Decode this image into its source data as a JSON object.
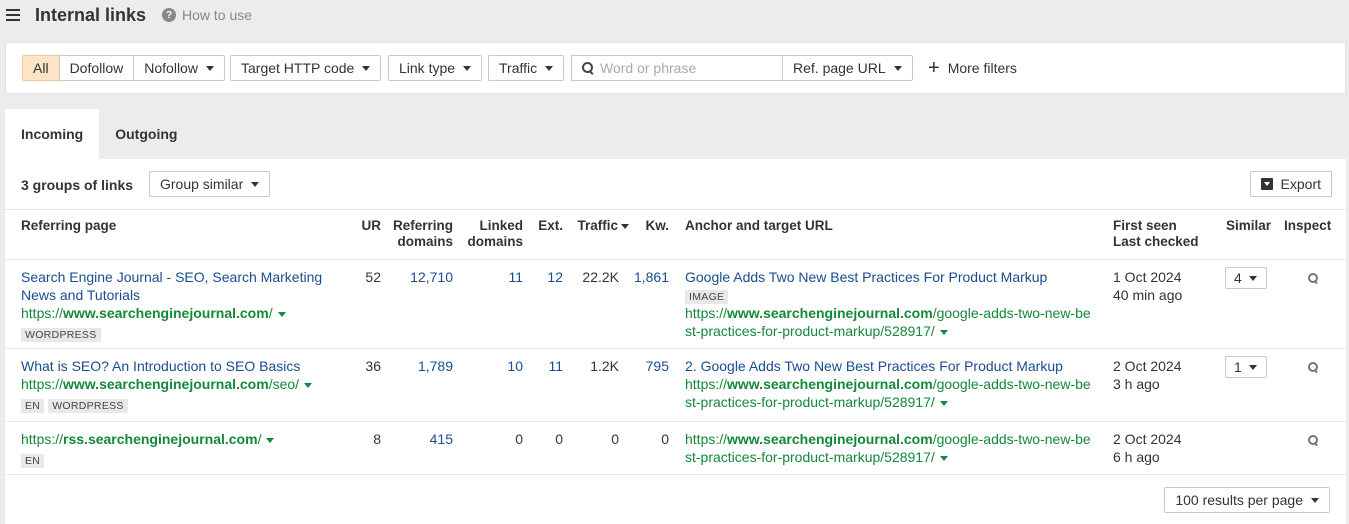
{
  "header": {
    "title": "Internal links",
    "help_label": "How to use",
    "help_icon": "question-circle-icon"
  },
  "filters": {
    "segment": [
      "All",
      "Dofollow",
      "Nofollow"
    ],
    "target_http_code": "Target HTTP code",
    "link_type": "Link type",
    "traffic": "Traffic",
    "search_placeholder": "Word or phrase",
    "search_value": "",
    "ref_page_url": "Ref. page URL",
    "more_filters": "More filters"
  },
  "tabs": [
    "Incoming",
    "Outgoing"
  ],
  "toolbar": {
    "groups_count": "3 groups of links",
    "group_similar": "Group similar",
    "export": "Export"
  },
  "table": {
    "columns": {
      "referring_page": "Referring page",
      "ur": "UR",
      "referring_domains": [
        "Referring",
        "domains"
      ],
      "linked_domains": [
        "Linked",
        "domains"
      ],
      "ext": "Ext.",
      "traffic": "Traffic",
      "kw": "Kw.",
      "anchor": "Anchor and target URL",
      "first_seen": "First seen",
      "last_checked": "Last checked",
      "similar": "Similar",
      "inspect": "Inspect"
    },
    "rows": [
      {
        "title": [
          "Search Engine Journal - SEO, Search Marketing",
          "News and Tutorials"
        ],
        "url_prefix": "https://",
        "url_domain": "www.searchenginejournal.com",
        "url_path": "/",
        "tags": [
          "WORDPRESS"
        ],
        "ur": "52",
        "ref_domains": "12,710",
        "linked_domains": "11",
        "ext": "12",
        "traffic": "22.2K",
        "kw": "1,861",
        "anchor": "Google Adds Two New Best Practices For Product Markup",
        "anchor_tag": "IMAGE",
        "target_prefix": "https://",
        "target_domain": "www.searchenginejournal.com",
        "target_path1": "/google-adds-two-new-be",
        "target_path2": "st-practices-for-product-markup/528917/",
        "first_seen": "1 Oct 2024",
        "last_checked": "40 min ago",
        "similar": "4"
      },
      {
        "title": [
          "What is SEO? An Introduction to SEO Basics"
        ],
        "url_prefix": "https://",
        "url_domain": "www.searchenginejournal.com",
        "url_path": "/seo/",
        "tags": [
          "EN",
          "WORDPRESS"
        ],
        "ur": "36",
        "ref_domains": "1,789",
        "linked_domains": "10",
        "ext": "11",
        "traffic": "1.2K",
        "kw": "795",
        "anchor": "2. Google Adds Two New Best Practices For Product Markup",
        "target_prefix": "https://",
        "target_domain": "www.searchenginejournal.com",
        "target_path1": "/google-adds-two-new-be",
        "target_path2": "st-practices-for-product-markup/528917/",
        "first_seen": "2 Oct 2024",
        "last_checked": "3 h ago",
        "similar": "1"
      },
      {
        "url_prefix": "https://",
        "url_domain": "rss.searchenginejournal.com",
        "url_path": "/",
        "tags": [
          "EN"
        ],
        "ur": "8",
        "ref_domains": "415",
        "linked_domains": "0",
        "ext": "0",
        "traffic": "0",
        "kw": "0",
        "target_prefix": "https://",
        "target_domain": "www.searchenginejournal.com",
        "target_path1": "/google-adds-two-new-be",
        "target_path2": "st-practices-for-product-markup/528917/",
        "first_seen": "2 Oct 2024",
        "last_checked": "6 h ago"
      }
    ]
  },
  "pagination": {
    "per_page": "100 results per page"
  },
  "colors": {
    "accent_segment": "#fde3c7",
    "link": "#1a4d8f",
    "url_green": "#13883a"
  }
}
